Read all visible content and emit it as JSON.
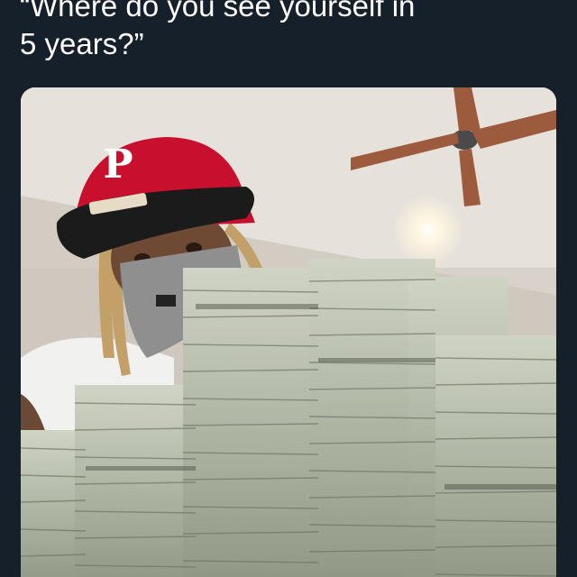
{
  "tweet": {
    "text": "“Where do you see yourself in\n5 years?”"
  },
  "media": {
    "description_icon": "photo-icon"
  }
}
